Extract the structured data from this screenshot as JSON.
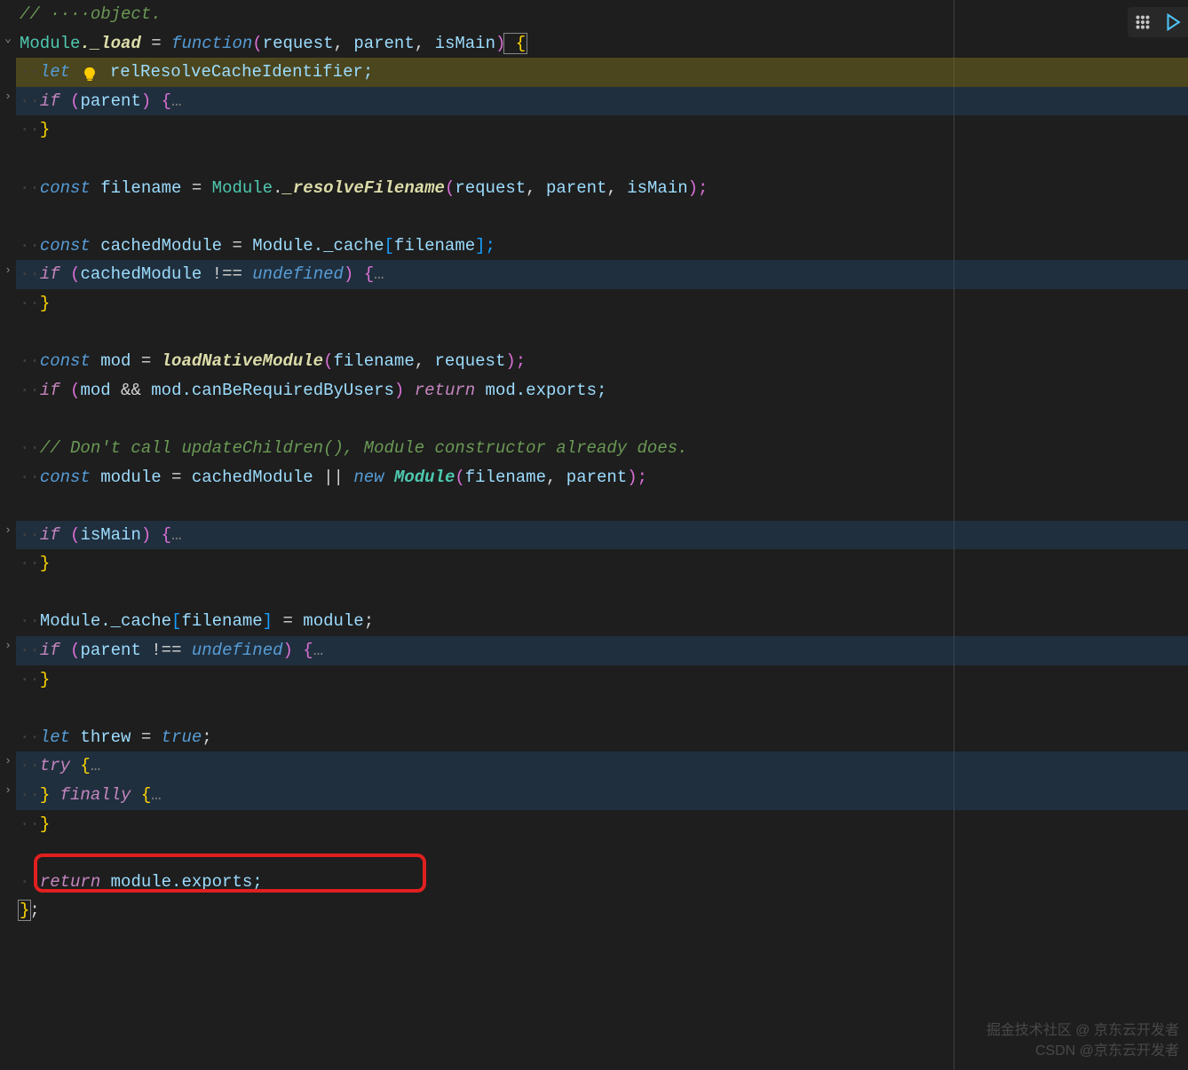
{
  "toolbar": {
    "drag": "drag-icon",
    "play": "play-icon"
  },
  "code": {
    "l0_comment_objdot": "// ····object.",
    "l1": {
      "p0": "Module",
      "p1": "._load",
      "p2": " = ",
      "p3": "function",
      "p4": "(",
      "p5": "request",
      "p6": ", ",
      "p7": "parent",
      "p8": ", ",
      "p9": "isMain",
      "p10": ")",
      "p11": " {"
    },
    "l2": {
      "dots": "··",
      "let": "let",
      "var": " relResolveCacheIdentifier;"
    },
    "l3": {
      "dots": "··",
      "if": "if",
      "p1": " (",
      "var": "parent",
      "p2": ") {",
      "fold": "…"
    },
    "l4": {
      "dots": "··",
      "brace": "}"
    },
    "l6": {
      "dots": "··",
      "const": "const",
      "var": " filename",
      "eq": " = ",
      "obj": "Module",
      "dot": ".",
      "fn": "_resolveFilename",
      "open": "(",
      "a1": "request",
      "c": ", ",
      "a2": "parent",
      "c2": ", ",
      "a3": "isMain",
      "close": ");"
    },
    "l8": {
      "dots": "··",
      "const": "const",
      "var": " cachedModule",
      "eq": " = ",
      "obj": "Module._cache",
      "br": "[",
      "idx": "filename",
      "br2": "];"
    },
    "l9": {
      "dots": "··",
      "if": "if",
      "p1": " (",
      "var": "cachedModule",
      "op": " !== ",
      "undef": "undefined",
      "p2": ") {",
      "fold": "…"
    },
    "l10": {
      "dots": "··",
      "brace": "}"
    },
    "l12": {
      "dots": "··",
      "const": "const",
      "var": " mod",
      "eq": " = ",
      "fn": "loadNativeModule",
      "open": "(",
      "a1": "filename",
      "c": ", ",
      "a2": "request",
      "close": ");"
    },
    "l13": {
      "dots": "··",
      "if": "if",
      "p1": " (",
      "v1": "mod",
      "op": " && ",
      "v2": "mod.canBeRequiredByUsers",
      "p2": ") ",
      "ret": "return",
      "exp": " mod.exports;"
    },
    "l15": {
      "dots": "··",
      "txt": "// Don't call updateChildren(), Module constructor already does."
    },
    "l16": {
      "dots": "··",
      "const": "const",
      "var": " module",
      "eq": " = ",
      "v1": "cachedModule",
      "op": " || ",
      "new": "new",
      "sp": " ",
      "cls": "Module",
      "open": "(",
      "a1": "filename",
      "c": ", ",
      "a2": "parent",
      "close": ");"
    },
    "l18": {
      "dots": "··",
      "if": "if",
      "p1": " (",
      "var": "isMain",
      "p2": ") {",
      "fold": "…"
    },
    "l19": {
      "dots": "··",
      "brace": "}"
    },
    "l21": {
      "dots": "··",
      "obj": "Module._cache",
      "br": "[",
      "idx": "filename",
      "br2": "]",
      "eq": " = ",
      "v": "module",
      "end": ";"
    },
    "l22": {
      "dots": "··",
      "if": "if",
      "p1": " (",
      "var": "parent",
      "op": " !== ",
      "undef": "undefined",
      "p2": ") {",
      "fold": "…"
    },
    "l23": {
      "dots": "··",
      "brace": "}"
    },
    "l25": {
      "dots": "··",
      "let": "let",
      "var": " threw",
      "eq": " = ",
      "bool": "true",
      "end": ";"
    },
    "l26": {
      "dots": "··",
      "try": "try",
      "brace": " {",
      "fold": "…"
    },
    "l27": {
      "dots": "··",
      "brace1": "}",
      "finally": " finally",
      "brace2": " {",
      "fold": "…"
    },
    "l28": {
      "dots": "··",
      "brace": "}"
    },
    "l30": {
      "dots": "··",
      "ret": "return",
      "exp": " module.exports;"
    },
    "l31": {
      "brace": "}",
      "end": ";"
    }
  },
  "watermark": {
    "line1": "掘金技术社区 @ 京东云开发者",
    "line2": "CSDN @京东云开发者"
  }
}
